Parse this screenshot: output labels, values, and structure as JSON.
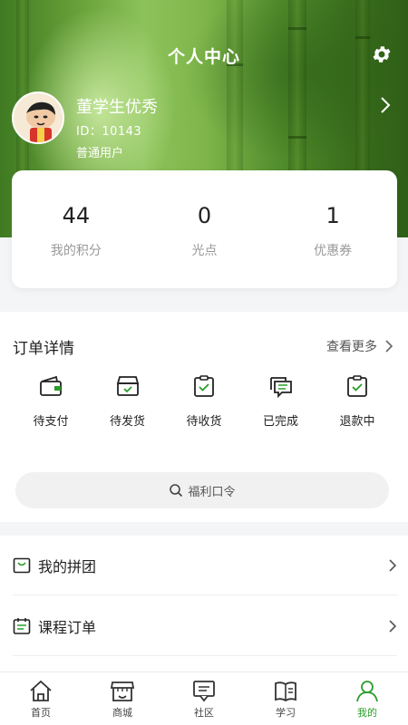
{
  "header": {
    "title": "个人中心",
    "settings_icon": "gear-icon"
  },
  "profile": {
    "name": "董学生优秀",
    "id_text": "ID：10143",
    "user_type": "普通用户"
  },
  "stats": [
    {
      "value": "44",
      "label": "我的积分"
    },
    {
      "value": "0",
      "label": "光点"
    },
    {
      "value": "1",
      "label": "优惠券"
    }
  ],
  "orders": {
    "title": "订单详情",
    "more_label": "查看更多",
    "items": [
      {
        "label": "待支付",
        "icon": "wallet-icon"
      },
      {
        "label": "待发货",
        "icon": "box-icon"
      },
      {
        "label": "待收货",
        "icon": "clipboard-check-icon"
      },
      {
        "label": "已完成",
        "icon": "message-list-icon"
      },
      {
        "label": "退款中",
        "icon": "clipboard-check-icon"
      }
    ]
  },
  "search": {
    "placeholder": "福利口令"
  },
  "menu": [
    {
      "label": "我的拼团",
      "icon": "shopping-bag-icon"
    },
    {
      "label": "课程订单",
      "icon": "calendar-list-icon"
    }
  ],
  "tabbar": {
    "active_color": "#2a9d2a",
    "items": [
      {
        "label": "首页",
        "icon": "home-icon"
      },
      {
        "label": "商城",
        "icon": "store-icon"
      },
      {
        "label": "社区",
        "icon": "community-icon"
      },
      {
        "label": "学习",
        "icon": "book-icon"
      },
      {
        "label": "我的",
        "icon": "user-icon"
      }
    ]
  }
}
